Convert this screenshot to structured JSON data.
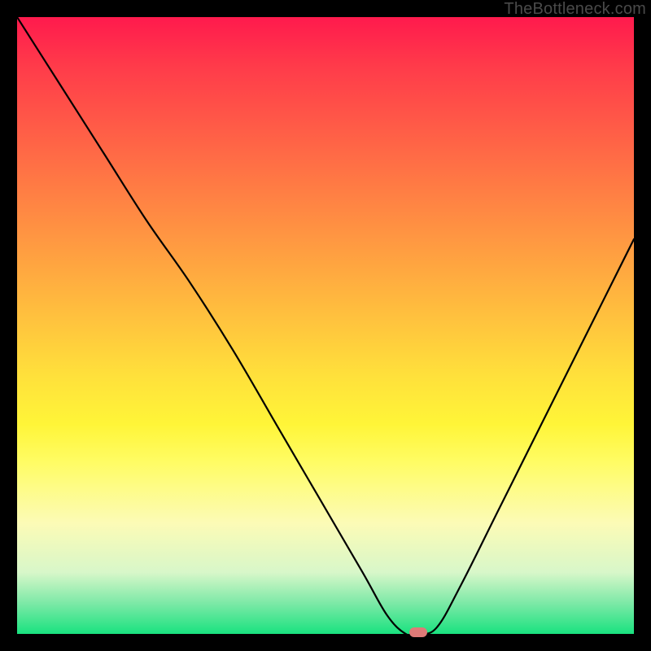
{
  "watermark": "TheBottleneck.com",
  "colors": {
    "frame": "#000000",
    "curve": "#000000",
    "marker": "#de7a77",
    "gradient_top": "#ff1a4d",
    "gradient_bottom": "#19e27f"
  },
  "chart_data": {
    "type": "line",
    "title": "",
    "xlabel": "",
    "ylabel": "",
    "xlim": [
      0,
      100
    ],
    "ylim": [
      0,
      100
    ],
    "grid": false,
    "legend": false,
    "series": [
      {
        "name": "bottleneck-curve",
        "x": [
          0,
          7,
          14,
          21,
          28,
          35,
          42,
          49,
          56,
          60,
          63,
          65,
          68,
          72,
          78,
          85,
          92,
          100
        ],
        "values": [
          100,
          89,
          78,
          67,
          57,
          46,
          34,
          22,
          10,
          3,
          0,
          0,
          1,
          8,
          20,
          34,
          48,
          64
        ]
      }
    ],
    "marker": {
      "x": 65,
      "y": 0
    },
    "annotations": []
  }
}
